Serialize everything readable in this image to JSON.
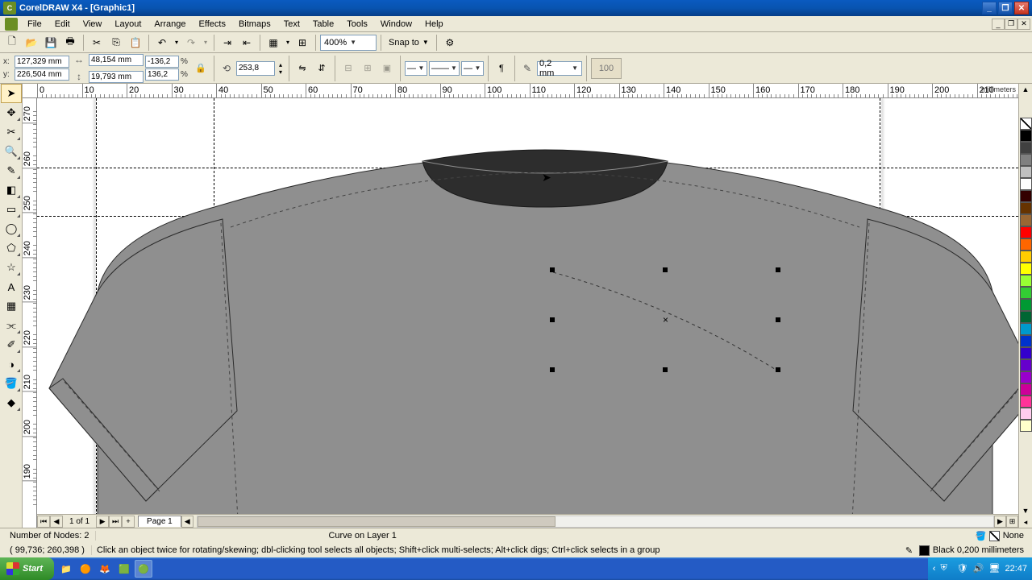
{
  "app": {
    "title": "CorelDRAW X4 - [Graphic1]"
  },
  "menu": [
    "File",
    "Edit",
    "View",
    "Layout",
    "Arrange",
    "Effects",
    "Bitmaps",
    "Text",
    "Table",
    "Tools",
    "Window",
    "Help"
  ],
  "toolbar": {
    "zoom": "400%",
    "snap": "Snap to"
  },
  "propbar": {
    "x": "127,329 mm",
    "y": "226,504 mm",
    "w": "48,154 mm",
    "h": "19,793 mm",
    "sx": "-136,2",
    "sy": "136,2",
    "rot": "253,8",
    "outline": "0,2 mm",
    "trans": "100"
  },
  "ruler": {
    "unit": "millimeters",
    "h_ticks": [
      0,
      10,
      20,
      30,
      40,
      50,
      60,
      70,
      80,
      90,
      100,
      110,
      120,
      130,
      140,
      150,
      160,
      170,
      180,
      190,
      200,
      210
    ],
    "v_ticks": [
      270,
      260,
      250,
      240,
      230,
      220,
      210,
      200,
      190
    ]
  },
  "pagebar": {
    "info": "1 of 1",
    "tab": "Page 1"
  },
  "status": {
    "nodes": "Number of Nodes: 2",
    "layer": "Curve on Layer 1",
    "coords": "( 99,736; 260,398 )",
    "hint": "Click an object twice for rotating/skewing; dbl-clicking tool selects all objects; Shift+click multi-selects; Alt+click digs; Ctrl+click selects in a group",
    "fill": "None",
    "outline": "Black  0,200 millimeters"
  },
  "taskbar": {
    "start": "Start",
    "time": "22:47"
  },
  "palette_colors": [
    "#000000",
    "#404040",
    "#808080",
    "#c0c0c0",
    "#ffffff",
    "#330000",
    "#663300",
    "#996633",
    "#ff0000",
    "#ff6600",
    "#ffcc00",
    "#ffff00",
    "#99ff33",
    "#33cc33",
    "#009933",
    "#006633",
    "#0099cc",
    "#0033cc",
    "#3300cc",
    "#6600cc",
    "#9900cc",
    "#cc0099",
    "#ff3399",
    "#ffccee",
    "#ffffcc"
  ]
}
